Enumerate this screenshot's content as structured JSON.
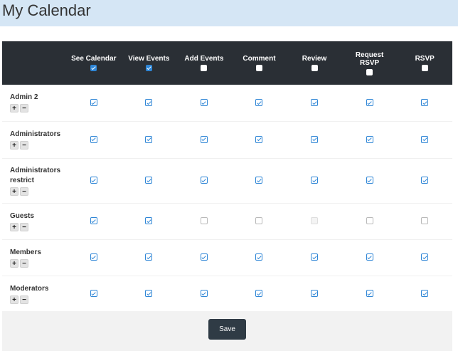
{
  "page": {
    "title": "My Calendar"
  },
  "columns": [
    {
      "label": "See Calendar",
      "all_checked": true
    },
    {
      "label": "View Events",
      "all_checked": true
    },
    {
      "label": "Add Events",
      "all_checked": false
    },
    {
      "label": "Comment",
      "all_checked": false
    },
    {
      "label": "Review",
      "all_checked": false
    },
    {
      "label": "Request\nRSVP",
      "all_checked": false
    },
    {
      "label": "RSVP",
      "all_checked": false
    }
  ],
  "groups": [
    {
      "name": "Admin 2",
      "perms": [
        "checked",
        "checked",
        "checked",
        "checked",
        "checked",
        "checked",
        "checked"
      ]
    },
    {
      "name": "Administrators",
      "perms": [
        "checked",
        "checked",
        "checked",
        "checked",
        "checked",
        "checked",
        "checked"
      ]
    },
    {
      "name": "Administrators restrict",
      "perms": [
        "checked",
        "checked",
        "checked",
        "checked",
        "checked",
        "checked",
        "checked"
      ]
    },
    {
      "name": "Guests",
      "perms": [
        "checked",
        "checked",
        "unchecked",
        "unchecked",
        "disabled",
        "unchecked",
        "unchecked"
      ]
    },
    {
      "name": "Members",
      "perms": [
        "checked",
        "checked",
        "checked",
        "checked",
        "checked",
        "checked",
        "checked"
      ]
    },
    {
      "name": "Moderators",
      "perms": [
        "checked",
        "checked",
        "checked",
        "checked",
        "checked",
        "checked",
        "checked"
      ]
    }
  ],
  "row_buttons": {
    "plus": "+",
    "minus": "−"
  },
  "footer": {
    "save_label": "Save"
  },
  "colors": {
    "header_bg": "#2a2f35",
    "check_blue": "#2f86d6",
    "title_bar_bg": "#d5e6f5",
    "save_bg": "#2f3b45"
  }
}
